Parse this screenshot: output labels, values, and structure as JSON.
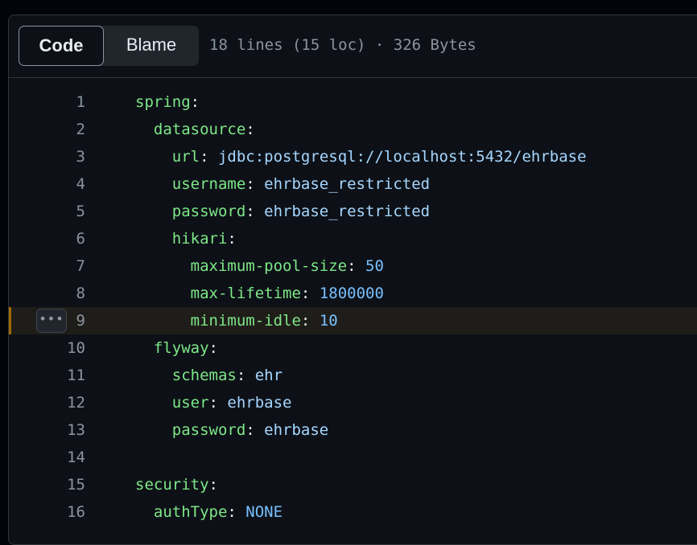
{
  "header": {
    "tabs": [
      {
        "label": "Code",
        "selected": true
      },
      {
        "label": "Blame",
        "selected": false
      }
    ],
    "file_info": "18 lines (15 loc) · 326 Bytes"
  },
  "more_button_label": "•••",
  "lines": [
    {
      "num": "1",
      "indent": "",
      "key": "spring",
      "sep": ":",
      "value": "",
      "vtype": ""
    },
    {
      "num": "2",
      "indent": "  ",
      "key": "datasource",
      "sep": ":",
      "value": "",
      "vtype": ""
    },
    {
      "num": "3",
      "indent": "    ",
      "key": "url",
      "sep": ": ",
      "value": "jdbc:postgresql://localhost:5432/ehrbase",
      "vtype": "v"
    },
    {
      "num": "4",
      "indent": "    ",
      "key": "username",
      "sep": ": ",
      "value": "ehrbase_restricted",
      "vtype": "v"
    },
    {
      "num": "5",
      "indent": "    ",
      "key": "password",
      "sep": ": ",
      "value": "ehrbase_restricted",
      "vtype": "v"
    },
    {
      "num": "6",
      "indent": "    ",
      "key": "hikari",
      "sep": ":",
      "value": "",
      "vtype": ""
    },
    {
      "num": "7",
      "indent": "      ",
      "key": "maximum-pool-size",
      "sep": ": ",
      "value": "50",
      "vtype": "n"
    },
    {
      "num": "8",
      "indent": "      ",
      "key": "max-lifetime",
      "sep": ": ",
      "value": "1800000",
      "vtype": "n"
    },
    {
      "num": "9",
      "indent": "      ",
      "key": "minimum-idle",
      "sep": ": ",
      "value": "10",
      "vtype": "n",
      "highlighted": true
    },
    {
      "num": "10",
      "indent": "  ",
      "key": "flyway",
      "sep": ":",
      "value": "",
      "vtype": ""
    },
    {
      "num": "11",
      "indent": "    ",
      "key": "schemas",
      "sep": ": ",
      "value": "ehr",
      "vtype": "v"
    },
    {
      "num": "12",
      "indent": "    ",
      "key": "user",
      "sep": ": ",
      "value": "ehrbase",
      "vtype": "v"
    },
    {
      "num": "13",
      "indent": "    ",
      "key": "password",
      "sep": ": ",
      "value": "ehrbase",
      "vtype": "v"
    },
    {
      "num": "14",
      "indent": "",
      "key": "",
      "sep": "",
      "value": "",
      "vtype": ""
    },
    {
      "num": "15",
      "indent": "",
      "key": "security",
      "sep": ":",
      "value": "",
      "vtype": ""
    },
    {
      "num": "16",
      "indent": "  ",
      "key": "authType",
      "sep": ": ",
      "value": "NONE",
      "vtype": "n"
    }
  ],
  "colors": {
    "key": "#7ee787",
    "string": "#a5d6ff",
    "constant": "#79c0ff",
    "line_number": "#8b949e",
    "highlight_marker": "#9e6a03"
  }
}
